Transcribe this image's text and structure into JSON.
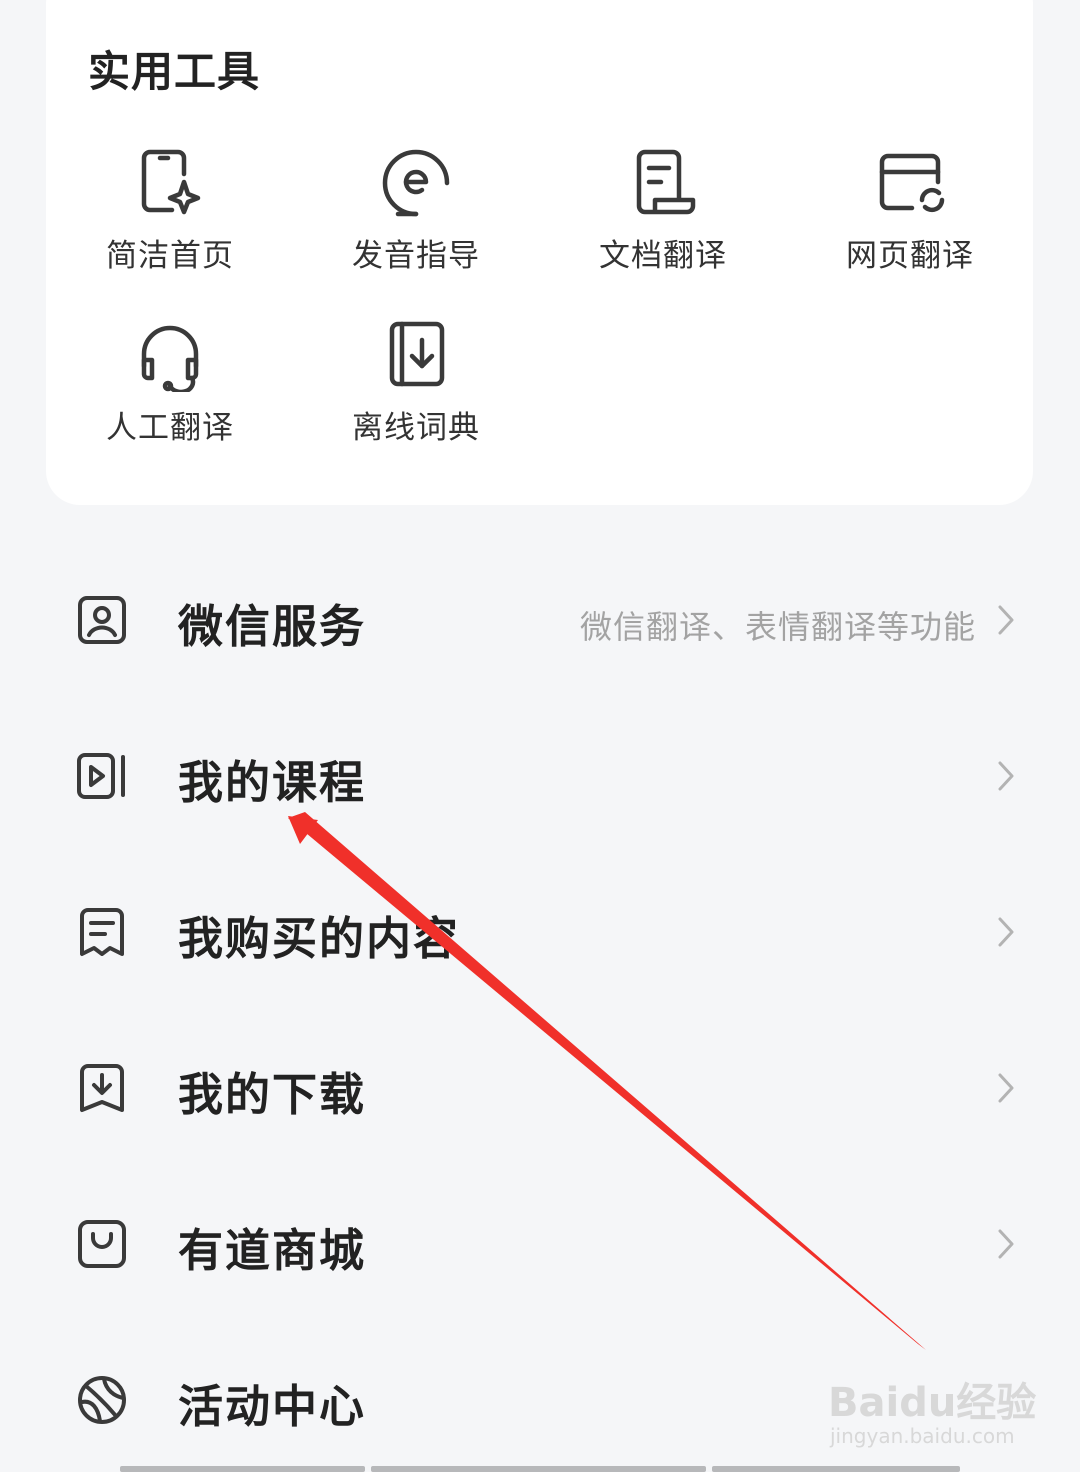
{
  "tools_card": {
    "title": "实用工具",
    "tools": [
      {
        "label": "简洁首页",
        "icon": "phone-sparkle-icon"
      },
      {
        "label": "发音指导",
        "icon": "pronunciation-icon"
      },
      {
        "label": "文档翻译",
        "icon": "document-icon"
      },
      {
        "label": "网页翻译",
        "icon": "webpage-translate-icon"
      },
      {
        "label": "人工翻译",
        "icon": "headset-icon"
      },
      {
        "label": "离线词典",
        "icon": "offline-dictionary-icon"
      }
    ]
  },
  "menu": [
    {
      "title": "微信服务",
      "subtitle": "微信翻译、表情翻译等功能",
      "icon": "wechat-service-icon"
    },
    {
      "title": "我的课程",
      "subtitle": "",
      "icon": "course-video-icon"
    },
    {
      "title": "我购买的内容",
      "subtitle": "",
      "icon": "purchased-content-icon"
    },
    {
      "title": "我的下载",
      "subtitle": "",
      "icon": "download-icon"
    },
    {
      "title": "有道商城",
      "subtitle": "",
      "icon": "shop-bag-icon"
    },
    {
      "title": "活动中心",
      "subtitle": "",
      "icon": "activity-ball-icon"
    }
  ],
  "watermark": {
    "logo": "Baidu经验",
    "url": "jingyan.baidu.com"
  },
  "colors": {
    "annotation_arrow": "#f0302a",
    "icon_stroke": "#3a3a3a",
    "background": "#f5f6f8",
    "card": "#ffffff"
  }
}
